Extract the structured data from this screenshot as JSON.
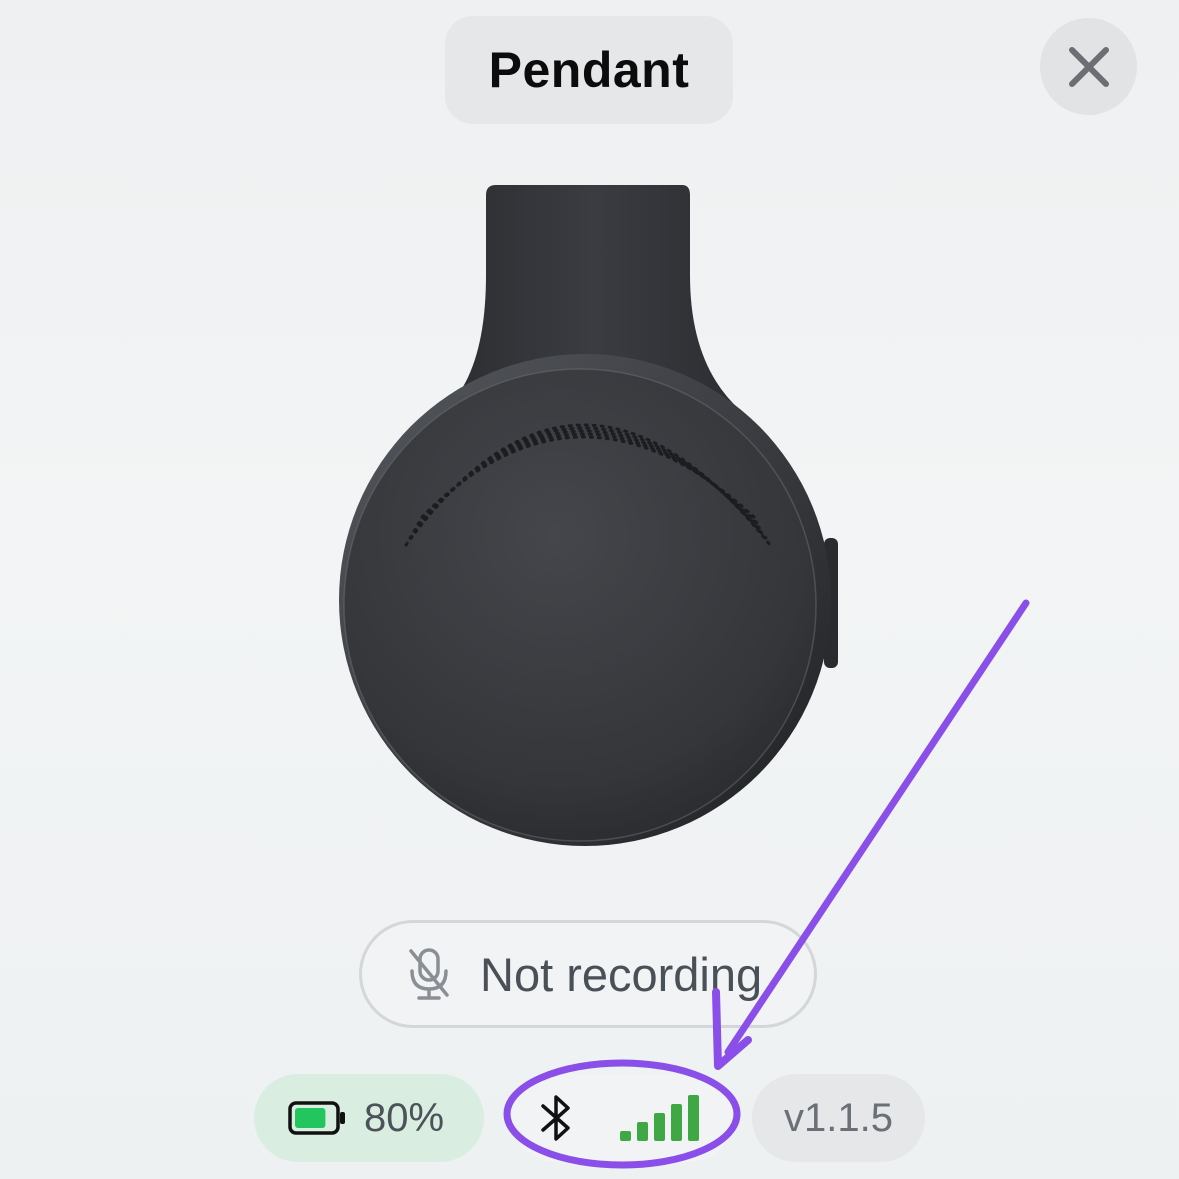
{
  "header": {
    "title": "Pendant"
  },
  "close_button": {
    "icon": "close-icon"
  },
  "device_image": {
    "subject": "pendant-device"
  },
  "recording_status": {
    "label": "Not recording",
    "icon": "mic-off-icon"
  },
  "status_bar": {
    "battery": {
      "label": "80%",
      "level": 0.8,
      "color": "#22c55e",
      "icon": "battery-icon"
    },
    "connection": {
      "bluetooth_icon": "bluetooth-icon",
      "signal_icon": "signal-strength-icon",
      "signal_bars": 5,
      "signal_active": 5,
      "signal_color": "#3fa845"
    },
    "version": {
      "label": "v1.1.5"
    }
  },
  "annotation": {
    "color": "#8a4fe8",
    "shapes": [
      "arrow",
      "ellipse"
    ]
  }
}
